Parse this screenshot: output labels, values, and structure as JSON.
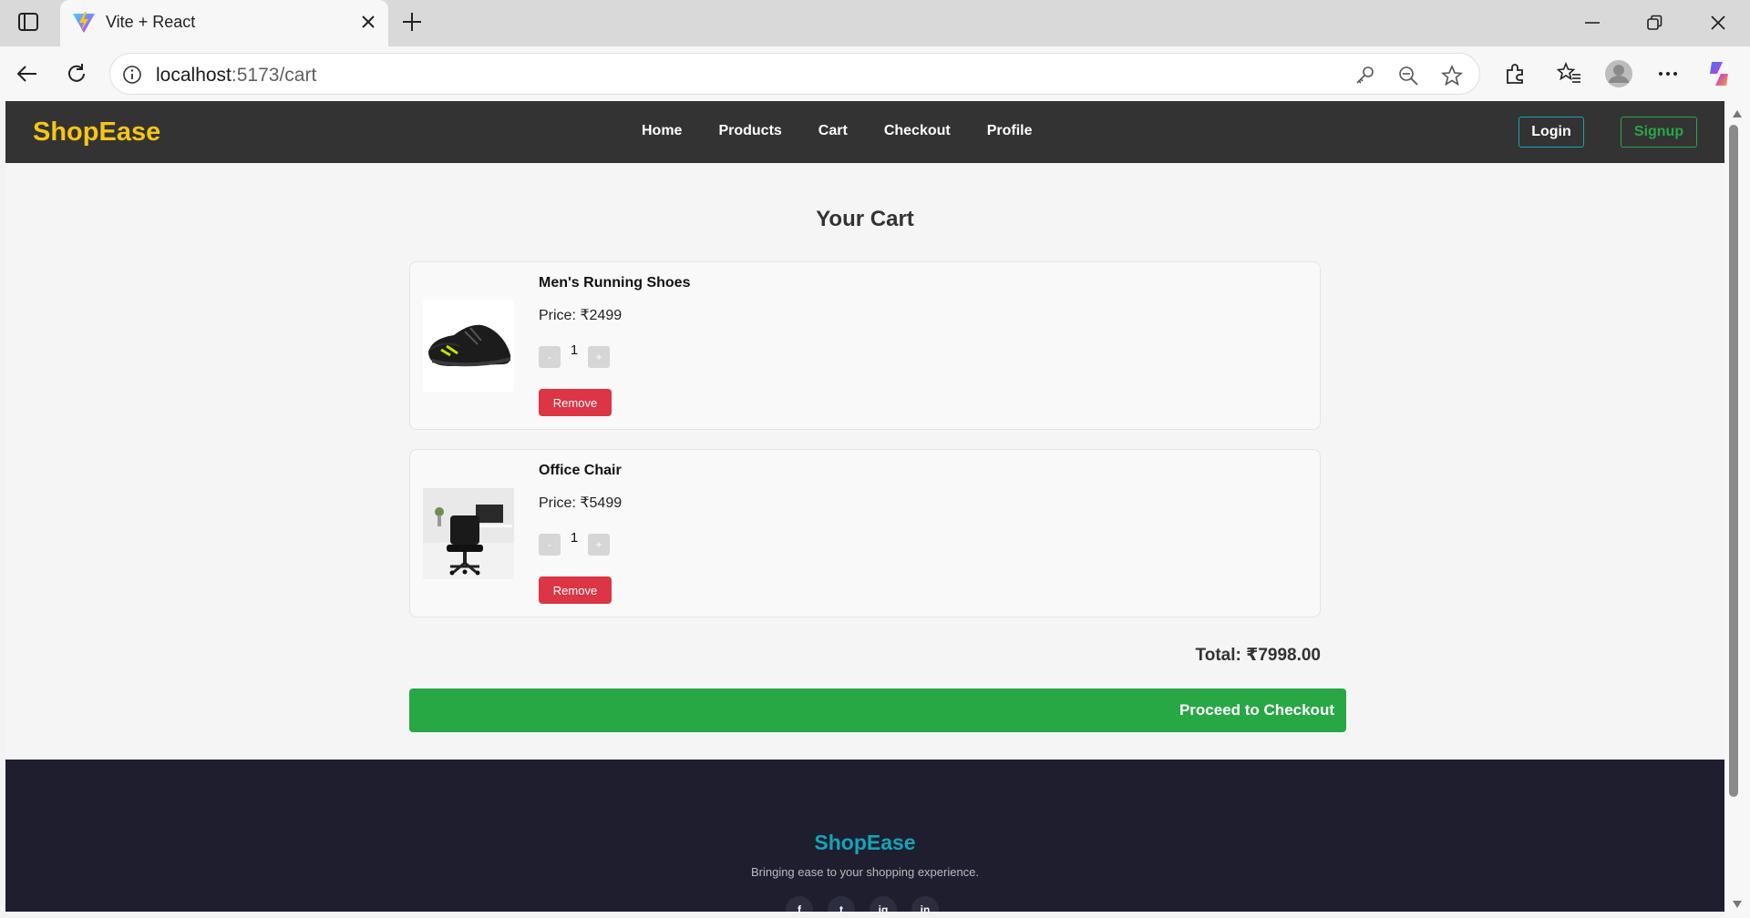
{
  "browser": {
    "tab_title": "Vite + React",
    "url_host": "localhost",
    "url_path": ":5173/cart"
  },
  "navbar": {
    "brand": "ShopEase",
    "links": [
      "Home",
      "Products",
      "Cart",
      "Checkout",
      "Profile"
    ],
    "login_label": "Login",
    "signup_label": "Signup",
    "colors": {
      "background": "#333333",
      "brand": "#f5c518",
      "login_border": "#17a2b8",
      "signup": "#28a745"
    }
  },
  "cart": {
    "title": "Your Cart",
    "items": [
      {
        "name": "Men's Running Shoes",
        "price": "Price: ₹2499",
        "quantity": "1",
        "minus": "-",
        "plus": "+",
        "remove_label": "Remove",
        "image_icon": "shoe-image"
      },
      {
        "name": "Office Chair",
        "price": "Price: ₹5499",
        "quantity": "1",
        "minus": "-",
        "plus": "+",
        "remove_label": "Remove",
        "image_icon": "chair-image"
      }
    ],
    "total": "Total: ₹7998.00",
    "checkout_label": "Proceed to Checkout",
    "colors": {
      "remove": "#dc3545",
      "checkout": "#28a745"
    }
  },
  "footer": {
    "brand": "ShopEase",
    "tagline": "Bringing ease to your shopping experience.",
    "socials": [
      "f",
      "t",
      "ig",
      "in"
    ]
  }
}
